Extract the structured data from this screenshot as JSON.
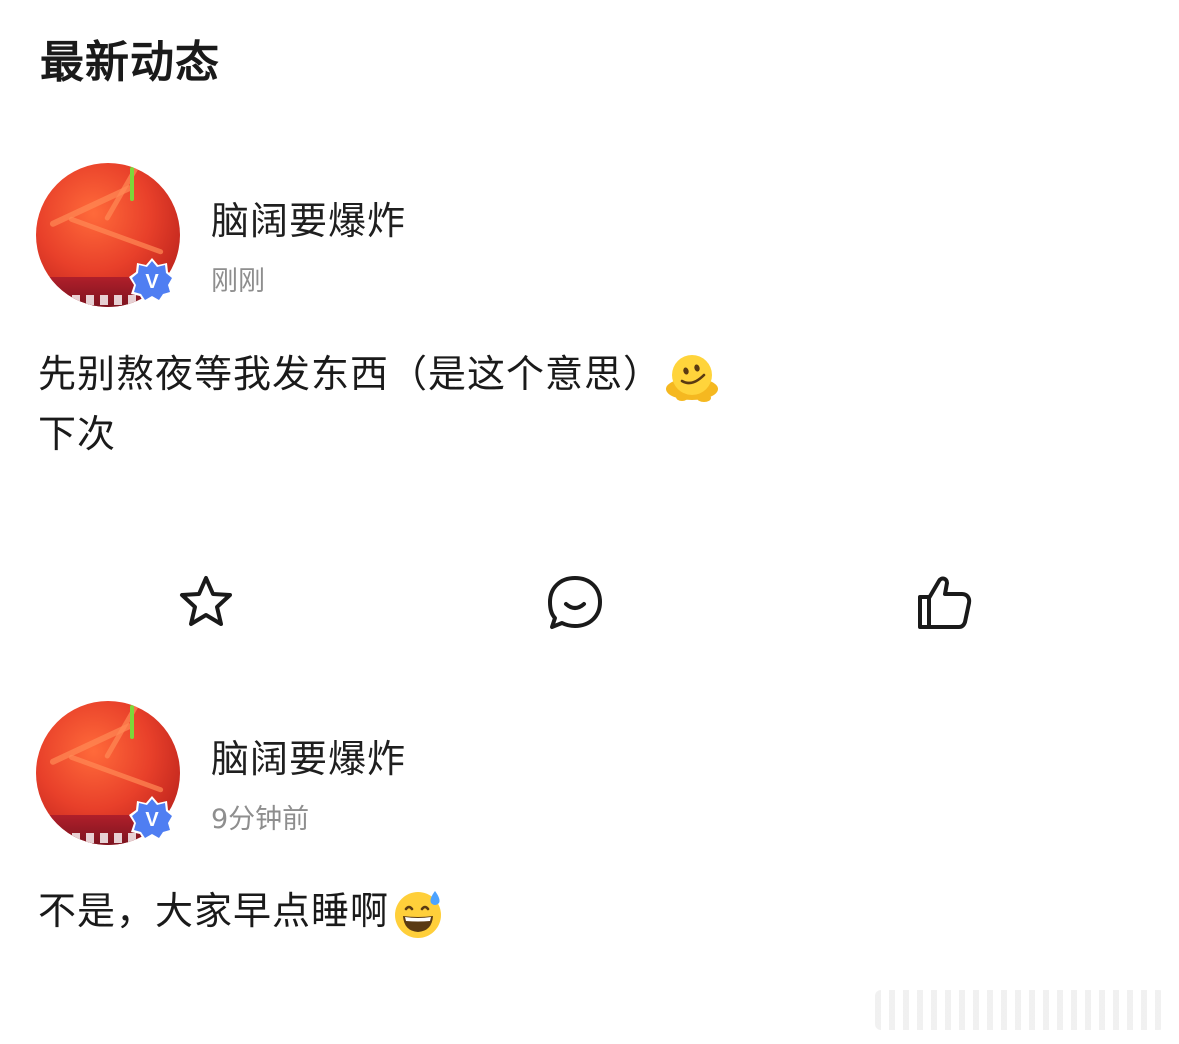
{
  "section": {
    "title": "最新动态"
  },
  "posts": [
    {
      "username": "脑阔要爆炸",
      "timestamp": "刚刚",
      "badge": "V",
      "lines": [
        "先别熬夜等我发东西（是这个意思）",
        "下次"
      ],
      "emoji": "melting-face-emoji"
    },
    {
      "username": "脑阔要爆炸",
      "timestamp": "9分钟前",
      "badge": "V",
      "lines": [
        "不是，大家早点睡啊"
      ],
      "emoji": "grinning-sweat-emoji"
    }
  ],
  "actions": {
    "favorite_icon": "star-icon",
    "comment_icon": "comment-bubble-icon",
    "like_icon": "thumbs-up-icon"
  },
  "colors": {
    "badge": "#4f7ef2",
    "timestamp": "#8e8e8e",
    "title_accent": "#ff8a3d"
  }
}
